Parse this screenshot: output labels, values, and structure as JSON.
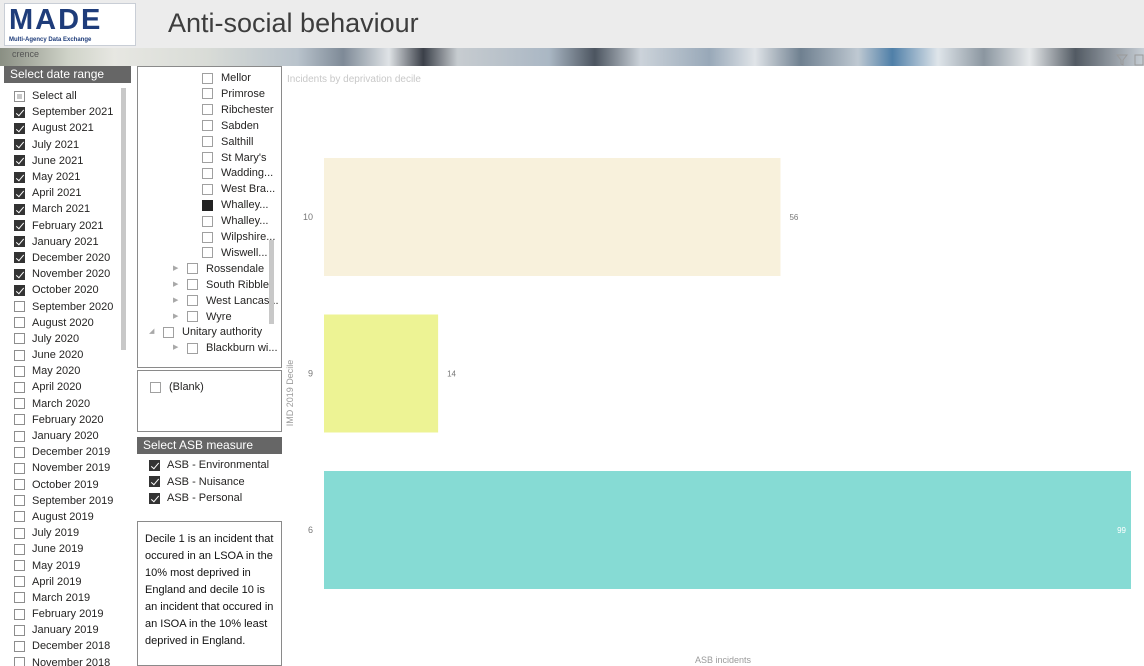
{
  "header": {
    "logo_text": "MADE",
    "logo_subtext": "Multi-Agency Data Exchange",
    "title": "Anti-social behaviour",
    "strip_text": "crence"
  },
  "date_range": {
    "header": "Select date range",
    "items": [
      {
        "label": "Select all",
        "state": "partial"
      },
      {
        "label": "September 2021",
        "state": "checked"
      },
      {
        "label": "August 2021",
        "state": "checked"
      },
      {
        "label": "July 2021",
        "state": "checked"
      },
      {
        "label": "June 2021",
        "state": "checked"
      },
      {
        "label": "May 2021",
        "state": "checked"
      },
      {
        "label": "April 2021",
        "state": "checked"
      },
      {
        "label": "March 2021",
        "state": "checked"
      },
      {
        "label": "February 2021",
        "state": "checked"
      },
      {
        "label": "January 2021",
        "state": "checked"
      },
      {
        "label": "December 2020",
        "state": "checked"
      },
      {
        "label": "November 2020",
        "state": "checked"
      },
      {
        "label": "October 2020",
        "state": "checked"
      },
      {
        "label": "September 2020",
        "state": "unchecked"
      },
      {
        "label": "August 2020",
        "state": "unchecked"
      },
      {
        "label": "July 2020",
        "state": "unchecked"
      },
      {
        "label": "June 2020",
        "state": "unchecked"
      },
      {
        "label": "May 2020",
        "state": "unchecked"
      },
      {
        "label": "April 2020",
        "state": "unchecked"
      },
      {
        "label": "March 2020",
        "state": "unchecked"
      },
      {
        "label": "February 2020",
        "state": "unchecked"
      },
      {
        "label": "January 2020",
        "state": "unchecked"
      },
      {
        "label": "December 2019",
        "state": "unchecked"
      },
      {
        "label": "November 2019",
        "state": "unchecked"
      },
      {
        "label": "October 2019",
        "state": "unchecked"
      },
      {
        "label": "September 2019",
        "state": "unchecked"
      },
      {
        "label": "August 2019",
        "state": "unchecked"
      },
      {
        "label": "July 2019",
        "state": "unchecked"
      },
      {
        "label": "June 2019",
        "state": "unchecked"
      },
      {
        "label": "May 2019",
        "state": "unchecked"
      },
      {
        "label": "April 2019",
        "state": "unchecked"
      },
      {
        "label": "March 2019",
        "state": "unchecked"
      },
      {
        "label": "February 2019",
        "state": "unchecked"
      },
      {
        "label": "January 2019",
        "state": "unchecked"
      },
      {
        "label": "December 2018",
        "state": "unchecked"
      },
      {
        "label": "November 2018",
        "state": "unchecked"
      }
    ]
  },
  "geography": {
    "items": [
      {
        "label": "Mellor",
        "level": 2,
        "state": "unchecked"
      },
      {
        "label": "Primrose",
        "level": 2,
        "state": "unchecked"
      },
      {
        "label": "Ribchester",
        "level": 2,
        "state": "unchecked"
      },
      {
        "label": "Sabden",
        "level": 2,
        "state": "unchecked"
      },
      {
        "label": "Salthill",
        "level": 2,
        "state": "unchecked"
      },
      {
        "label": "St Mary's",
        "level": 2,
        "state": "unchecked"
      },
      {
        "label": "Wadding...",
        "level": 2,
        "state": "unchecked"
      },
      {
        "label": "West Bra...",
        "level": 2,
        "state": "unchecked"
      },
      {
        "label": "Whalley...",
        "level": 2,
        "state": "filled"
      },
      {
        "label": "Whalley...",
        "level": 2,
        "state": "unchecked"
      },
      {
        "label": "Wilpshire...",
        "level": 2,
        "state": "unchecked"
      },
      {
        "label": "Wiswell...",
        "level": 2,
        "state": "unchecked"
      },
      {
        "label": "Rossendale",
        "level": 1,
        "state": "unchecked",
        "caret": "▶"
      },
      {
        "label": "South Ribble",
        "level": 1,
        "state": "unchecked",
        "caret": "▶"
      },
      {
        "label": "West Lancas...",
        "level": 1,
        "state": "unchecked",
        "caret": "▶"
      },
      {
        "label": "Wyre",
        "level": 1,
        "state": "unchecked",
        "caret": "▶"
      },
      {
        "label": "Unitary authority",
        "level": 0,
        "state": "unchecked",
        "caret": "◢"
      },
      {
        "label": "Blackburn wi...",
        "level": 1,
        "state": "unchecked",
        "caret": "▶"
      }
    ]
  },
  "blank_filter": {
    "label": "(Blank)",
    "state": "unchecked"
  },
  "asb_measure": {
    "header": "Select ASB measure",
    "items": [
      {
        "label": "ASB - Environmental",
        "state": "checked"
      },
      {
        "label": "ASB - Nuisance",
        "state": "checked"
      },
      {
        "label": "ASB - Personal",
        "state": "checked"
      }
    ]
  },
  "info_text": "Decile 1 is an incident that occured in an LSOA in the 10% most deprived in England and decile 10 is an incident that occured in an ISOA in the 10% least deprived in England.",
  "icons": {
    "filter": "filter-icon",
    "focus": "focus-mode-icon"
  },
  "chart_data": {
    "type": "bar",
    "orientation": "horizontal",
    "title": "Incidents by deprivation decile",
    "xlabel": "ASB incidents",
    "ylabel": "IMD 2019 Decile",
    "categories": [
      "10",
      "9",
      "6"
    ],
    "values": [
      56,
      14,
      99
    ],
    "colors": [
      "#f8f1dc",
      "#edf394",
      "#86dbd4"
    ],
    "xlim": [
      0,
      99
    ],
    "grid": false,
    "data_labels": true,
    "label_color": "#777777"
  }
}
